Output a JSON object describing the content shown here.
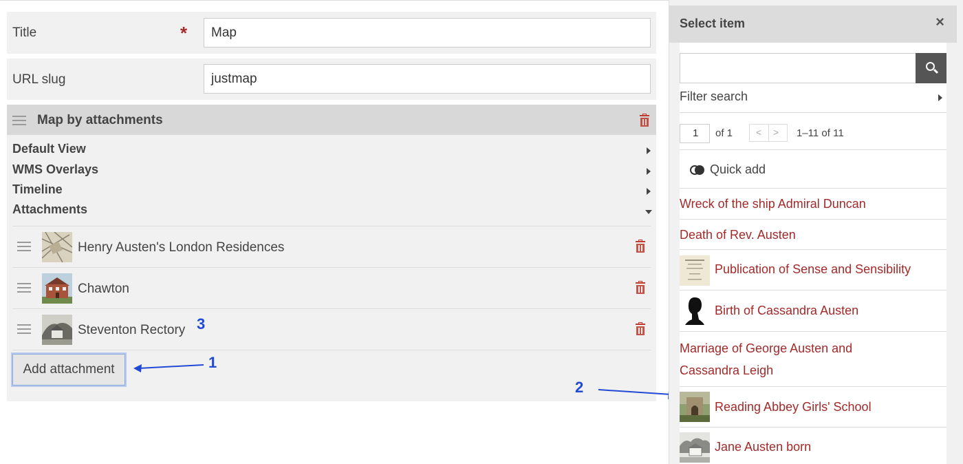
{
  "form": {
    "title_label": "Title",
    "title_required": "*",
    "title_value": "Map",
    "slug_label": "URL slug",
    "slug_value": "justmap"
  },
  "block": {
    "title": "Map by attachments",
    "sections": [
      {
        "label": "Default View",
        "state": "collapsed"
      },
      {
        "label": "WMS Overlays",
        "state": "collapsed"
      },
      {
        "label": "Timeline",
        "state": "collapsed"
      },
      {
        "label": "Attachments",
        "state": "expanded"
      }
    ],
    "attachments": [
      {
        "label": "Henry Austen's London Residences",
        "thumb": "map-thumbnail"
      },
      {
        "label": "Chawton",
        "thumb": "house-thumbnail"
      },
      {
        "label": "Steventon Rectory",
        "thumb": "rectory-thumbnail"
      }
    ],
    "add_button": "Add attachment"
  },
  "annotations": {
    "one": "1",
    "two": "2",
    "three": "3",
    "color": "#2149d6"
  },
  "panel": {
    "title": "Select item",
    "close": "×",
    "search_placeholder": "",
    "filter_label": "Filter search",
    "page_value": "1",
    "page_of": "of 1",
    "prev": "<",
    "next": ">",
    "range": "1–11 of 11",
    "quick_add": "Quick add",
    "results": [
      {
        "label": "Wreck of the ship Admiral Duncan",
        "thumb": ""
      },
      {
        "label": "Death of Rev. Austen",
        "thumb": ""
      },
      {
        "label": "Publication of Sense and Sensibility",
        "thumb": "book-page-thumbnail"
      },
      {
        "label": "Birth of Cassandra Austen",
        "thumb": "silhouette-thumbnail"
      },
      {
        "label": "Marriage of George Austen and Cassandra Leigh",
        "thumb": ""
      },
      {
        "label": "Reading Abbey Girls' School",
        "thumb": "abbey-thumbnail"
      },
      {
        "label": "Jane Austen born",
        "thumb": "church-thumbnail"
      }
    ]
  },
  "colors": {
    "accent_red": "#a42a2a",
    "annotation_blue": "#2149d6",
    "panel_bg": "#f1f1f1"
  }
}
